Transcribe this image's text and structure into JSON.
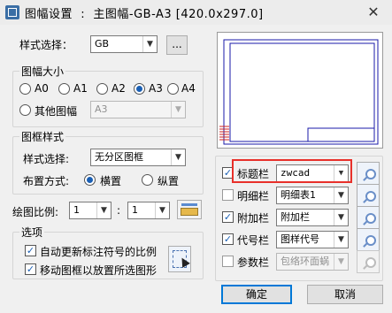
{
  "window": {
    "title": "图幅设置  :  主图幅-GB-A3 [420.0x297.0]"
  },
  "style_select": {
    "label": "样式选择：",
    "value": "GB",
    "more_label": "..."
  },
  "paper_size": {
    "title": "图幅大小",
    "options": [
      "A0",
      "A1",
      "A2",
      "A3",
      "A4"
    ],
    "selected": "A3",
    "other_label": "其他图幅",
    "other_value": "A3"
  },
  "frame_style": {
    "title": "图框样式",
    "select_label": "样式选择:",
    "select_value": "无分区图框",
    "layout_label": "布置方式:",
    "landscape": "横置",
    "portrait": "纵置",
    "selected": "横置"
  },
  "scale": {
    "label": "绘图比例:",
    "left": "1",
    "separator": ":",
    "right": "1"
  },
  "options": {
    "title": "选项",
    "auto_update": "自动更新标注符号的比例",
    "move_frame": "移动图框以放置所选图形"
  },
  "rows": [
    {
      "label": "标题栏",
      "value": "zwcad",
      "checked": true,
      "enabled": true,
      "highlight": true
    },
    {
      "label": "明细栏",
      "value": "明细表1",
      "checked": false,
      "enabled": true,
      "highlight": false
    },
    {
      "label": "附加栏",
      "value": "附加栏",
      "checked": true,
      "enabled": true,
      "highlight": false
    },
    {
      "label": "代号栏",
      "value": "图样代号",
      "checked": true,
      "enabled": true,
      "highlight": false
    },
    {
      "label": "参数栏",
      "value": "包络环面蜗",
      "checked": false,
      "enabled": false,
      "highlight": false
    }
  ],
  "buttons": {
    "ok": "确定",
    "cancel": "取消"
  },
  "colors": {
    "highlight": "#e8302a",
    "preview_line": "#1a1aa8",
    "preview_red": "#d02020"
  }
}
